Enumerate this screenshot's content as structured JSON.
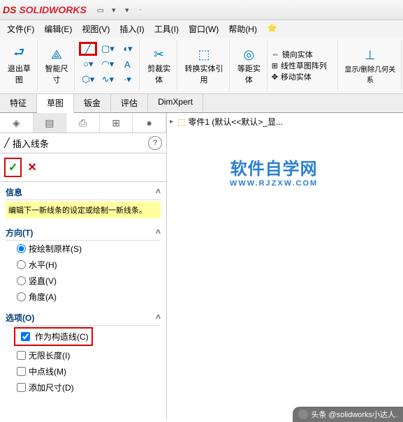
{
  "app": {
    "name": "SOLIDWORKS"
  },
  "menu": {
    "file": "文件(F)",
    "edit": "编辑(E)",
    "view": "视图(V)",
    "insert": "插入(I)",
    "tools": "工具(I)",
    "window": "窗口(W)",
    "help": "帮助(H)"
  },
  "ribbon": {
    "exit_sketch": "退出草图",
    "smart_dim": "智能尺寸",
    "trim": "剪裁实体",
    "convert": "转换实体",
    "convert_ref": "转换实体引用",
    "offset": "等距实体",
    "mirror": "镜向实体",
    "linear_pattern": "线性草图阵列",
    "move": "移动实体",
    "display": "显示/删除几何关系"
  },
  "tabs": {
    "feature": "特征",
    "sketch": "草图",
    "sheetmetal": "钣金",
    "evaluate": "评估",
    "dimxpert": "DimXpert"
  },
  "tree": {
    "part": "零件1 (默认<<默认>_显..."
  },
  "panel": {
    "title": "插入线条",
    "section_info": "信息",
    "info_text": "编辑下一新线条的设定或绘制一新线条。",
    "section_dir": "方向(T)",
    "dir_as_sketched": "按绘制原样(S)",
    "dir_horizontal": "水平(H)",
    "dir_vertical": "竖直(V)",
    "dir_angle": "角度(A)",
    "section_opts": "选项(O)",
    "opt_construction": "作为构造线(C)",
    "opt_infinite": "无限长度(I)",
    "opt_midpoint": "中点线(M)",
    "opt_add_dim": "添加尺寸(D)"
  },
  "watermark": {
    "l1": "软件自学网",
    "l2": "WWW.RJZXW.COM"
  },
  "footer": {
    "text": "头条 @solidworks小达人."
  }
}
